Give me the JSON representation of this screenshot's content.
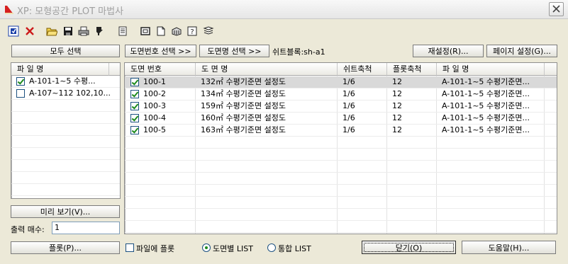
{
  "window": {
    "title": "XP: 모형공간 PLOT 마법사"
  },
  "toolbar": {
    "icons": [
      "select-icon",
      "delete-icon",
      "open-folder-icon",
      "save-icon",
      "print-icon",
      "page-marker-icon",
      "document-list-icon",
      "frame-icon",
      "blank-page-icon",
      "stamp-icon",
      "help-page-icon",
      "layers-icon"
    ]
  },
  "top_buttons": {
    "select_all": "모두 선택",
    "select_by_number": "도면번호 선택 >>",
    "select_by_name": "도면명 선택 >>",
    "sheet_block_label": "쉬트블록:sh-a1",
    "reset": "재설정(R)...",
    "page_setup": "페이지 설정(G)..."
  },
  "file_list": {
    "header": "파 일 명",
    "items": [
      {
        "name": "A-101-1~5 수평...",
        "checked": true
      },
      {
        "name": "A-107~112 102,10...",
        "checked": false
      }
    ]
  },
  "drawing_table": {
    "columns": [
      "도면 번호",
      "도 면 명",
      "쉬트축척",
      "플롯축척",
      "파 일 명"
    ],
    "rows": [
      [
        "100-1",
        "132㎡ 수평기준면 설정도",
        "1/6",
        "12",
        "A-101-1~5 수평기준면..."
      ],
      [
        "100-2",
        "134㎡ 수평기준면 설정도",
        "1/6",
        "12",
        "A-101-1~5 수평기준면..."
      ],
      [
        "100-3",
        "159㎡ 수평기준면 설정도",
        "1/6",
        "12",
        "A-101-1~5 수평기준면..."
      ],
      [
        "100-4",
        "160㎡ 수평기준면 설정도",
        "1/6",
        "12",
        "A-101-1~5 수평기준면..."
      ],
      [
        "100-5",
        "163㎡ 수평기준면 설정도",
        "1/6",
        "12",
        "A-101-1~5 수평기준면..."
      ]
    ]
  },
  "preview_button": "미리 보기(V)...",
  "copies": {
    "label": "출력 매수:",
    "value": "1"
  },
  "bottom": {
    "plot_button": "플롯(P)...",
    "plot_to_file": "파일에 플롯",
    "per_sheet_list": "도면별 LIST",
    "combined_list": "통합 LIST",
    "close_button": "닫기(O)",
    "help_button": "도움말(H)..."
  },
  "colors": {
    "face": "#ece9d8",
    "selected_row": "#d9d9d9",
    "check": "#1d8a1d",
    "accent_red": "#cc1a1a"
  }
}
